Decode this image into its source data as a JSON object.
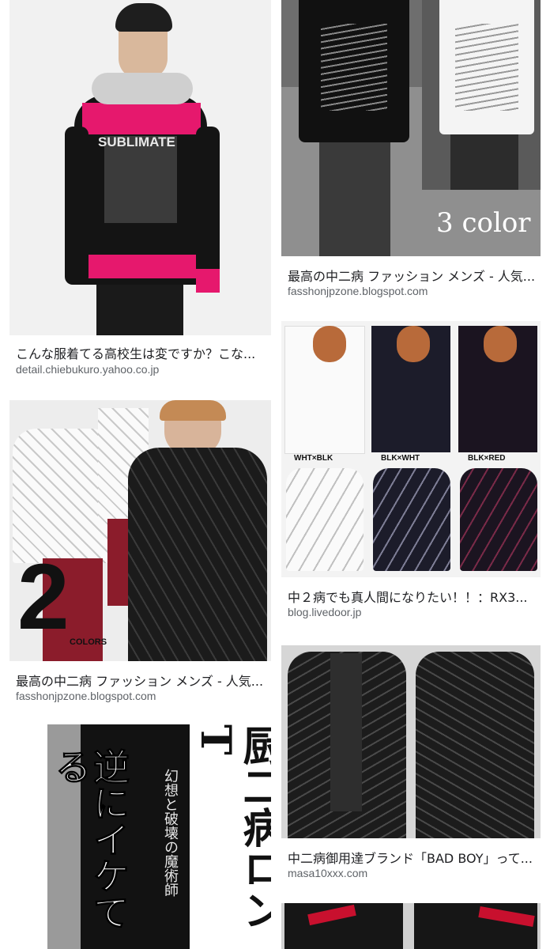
{
  "results": [
    {
      "title": "こんな服着てる高校生は変ですか？こな...",
      "domain": "detail.chiebukuro.yahoo.co.jp",
      "image_alt": "black and pink hoodie on model",
      "image_text": "SUBLIMATE"
    },
    {
      "title": "最高の中二病 ファッション メンズ - 人気...",
      "domain": "fasshonjpzone.blogspot.com",
      "image_alt": "two long sleeve shirts black and white",
      "image_text": "3 color"
    },
    {
      "title": "最高の中二病 ファッション メンズ - 人気...",
      "domain": "fasshonjpzone.blogspot.com",
      "image_alt": "white and black v-neck t-shirts",
      "image_text": "2",
      "image_subtext": "COLORS"
    },
    {
      "title": "中２病でも真人間になりたい！！：RX3...",
      "domain": "blog.livedoor.jp",
      "image_alt": "three long sleeve shirts color variations",
      "color_labels": [
        "WHT×BLK",
        "BLK×WHT",
        "BLK×RED"
      ]
    },
    {
      "title": "中二病御用達ブランド「BAD BOY」って...",
      "domain": "masa10xxx.com",
      "image_alt": "black printed shirt front and back"
    },
    {
      "title": "",
      "domain": "",
      "image_alt": "black long sleeve with large kanji text",
      "image_text_large": "厨二病ロンT",
      "image_text_side": "逆にイケてる",
      "image_text_vertical": "幻想と破壊の魔術師"
    },
    {
      "title": "",
      "domain": "",
      "image_alt": "black shirt with red tie"
    }
  ]
}
